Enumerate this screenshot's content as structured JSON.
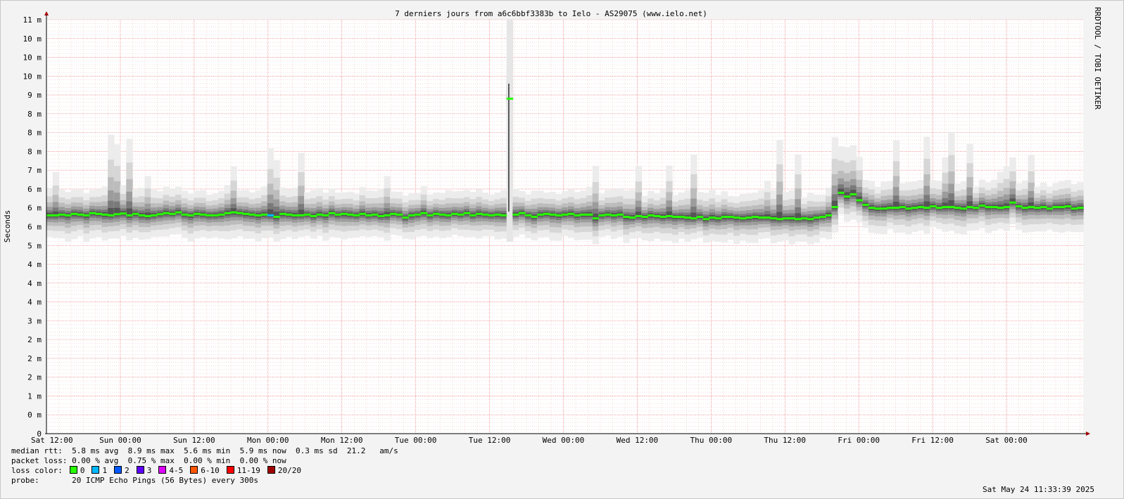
{
  "chart_data": {
    "type": "line",
    "title": "7 derniers jours from a6c6bbf3383b to Ielo - AS29075 (www.ielo.net)",
    "ylabel": "Seconds",
    "watermark": "RRDTOOL / TOBI OETIKER",
    "y_ticks": [
      "0",
      "0 m",
      "1 m",
      "2 m",
      "2 m",
      "2 m",
      "3 m",
      "4 m",
      "4 m",
      "4 m",
      "5 m",
      "6 m",
      "6 m",
      "6 m",
      "7 m",
      "8 m",
      "8 m",
      "8 m",
      "9 m",
      "10 m",
      "10 m",
      "10 m",
      "11 m"
    ],
    "ylim": [
      0,
      11
    ],
    "x_ticks": [
      "Sat 12:00",
      "Sun 00:00",
      "Sun 12:00",
      "Mon 00:00",
      "Mon 12:00",
      "Tue 00:00",
      "Tue 12:00",
      "Wed 00:00",
      "Wed 12:00",
      "Thu 00:00",
      "Thu 12:00",
      "Fri 00:00",
      "Fri 12:00",
      "Sat 00:00"
    ],
    "median_rtt_series": {
      "name": "median rtt",
      "unit": "ms",
      "values": [
        5.8,
        5.8,
        5.82,
        5.8,
        5.84,
        5.82,
        5.8,
        5.86,
        5.84,
        5.82,
        5.8,
        5.83,
        5.85,
        5.8,
        5.84,
        5.8,
        5.78,
        5.8,
        5.83,
        5.86,
        5.84,
        5.88,
        5.82,
        5.8,
        5.84,
        5.82,
        5.8,
        5.8,
        5.82,
        5.86,
        5.88,
        5.86,
        5.84,
        5.82,
        5.8,
        5.82,
        5.8,
        5.76,
        5.84,
        5.82,
        5.8,
        5.8,
        5.82,
        5.78,
        5.82,
        5.8,
        5.86,
        5.82,
        5.84,
        5.82,
        5.8,
        5.84,
        5.8,
        5.82,
        5.78,
        5.8,
        5.84,
        5.82,
        5.74,
        5.8,
        5.82,
        5.86,
        5.8,
        5.84,
        5.82,
        5.8,
        5.84,
        5.82,
        5.86,
        5.8,
        5.84,
        5.82,
        5.8,
        5.82,
        5.8,
        8.9,
        5.82,
        5.86,
        5.8,
        5.76,
        5.82,
        5.84,
        5.82,
        5.8,
        5.82,
        5.84,
        5.8,
        5.82,
        5.82,
        5.72,
        5.8,
        5.82,
        5.8,
        5.82,
        5.76,
        5.74,
        5.78,
        5.76,
        5.8,
        5.78,
        5.76,
        5.78,
        5.76,
        5.76,
        5.74,
        5.72,
        5.76,
        5.7,
        5.74,
        5.72,
        5.76,
        5.76,
        5.74,
        5.72,
        5.74,
        5.76,
        5.74,
        5.74,
        5.72,
        5.7,
        5.72,
        5.72,
        5.7,
        5.72,
        5.7,
        5.74,
        5.76,
        5.8,
        6.02,
        6.4,
        6.3,
        6.36,
        6.2,
        6.08,
        6.0,
        5.98,
        5.98,
        6.0,
        6.0,
        6.02,
        5.98,
        6.0,
        6.02,
        6.0,
        6.04,
        6.0,
        6.02,
        6.02,
        6.0,
        5.98,
        6.02,
        6.0,
        6.06,
        6.02,
        6.02,
        6.0,
        6.02,
        6.14,
        6.04,
        6.0,
        6.02,
        6.0,
        6.02,
        5.98,
        6.02,
        6.02,
        6.04,
        5.98,
        6.0
      ],
      "loss_color_series": "loss 0"
    },
    "stats": {
      "median_rtt": {
        "label": "median rtt:",
        "avg": "5.8 ms avg",
        "max": "8.9 ms max",
        "min": "5.6 ms min",
        "now": "5.9 ms now",
        "sd": "0.3 ms sd",
        "am": "21.2",
        "am_unit": "am/s"
      },
      "packet_loss": {
        "label": "packet loss:",
        "avg": "0.00 % avg",
        "max": "0.75 % max",
        "min": "0.00 % min",
        "now": "0.00 % now"
      },
      "loss_color": {
        "label": "loss color:",
        "items": [
          {
            "label": "0",
            "color": "#26ff00"
          },
          {
            "label": "1",
            "color": "#00b8ff"
          },
          {
            "label": "2",
            "color": "#0059ff"
          },
          {
            "label": "3",
            "color": "#5e00ff"
          },
          {
            "label": "4-5",
            "color": "#dd00ff"
          },
          {
            "label": "6-10",
            "color": "#ff5500"
          },
          {
            "label": "11-19",
            "color": "#ff0000"
          },
          {
            "label": "20/20",
            "color": "#a10000"
          }
        ]
      },
      "probe": {
        "label": "probe:",
        "text": "20 ICMP Echo Pings (56 Bytes) every 300s"
      }
    },
    "timestamp": "Sat May 24 11:33:39 2025",
    "grid": true,
    "colors": {
      "background": "#ffffff",
      "grid_major": "#f08080",
      "grid_minor": "#e8b8b8",
      "median": "#26ff00",
      "loss1": "#00b8ff"
    }
  }
}
